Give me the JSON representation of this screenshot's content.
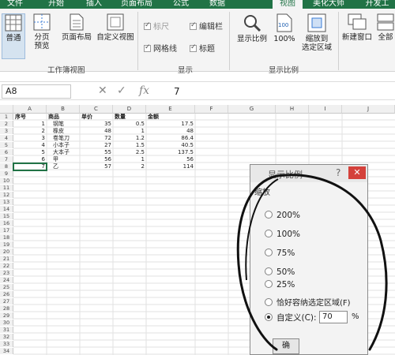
{
  "ribbon_tabs": [
    "文件",
    "开始",
    "插入",
    "页面布局",
    "公式",
    "数据",
    "视图",
    "美化大师",
    "开发工"
  ],
  "active_tab": "视图",
  "ribbon": {
    "normal": "普通",
    "page_break_1": "分页",
    "page_break_2": "预览",
    "page_layout": "页面布局",
    "custom_view": "自定义视图",
    "workbook_views_group": "工作簿视图",
    "ruler": "标尺",
    "formula_bar": "编辑栏",
    "gridlines": "网格线",
    "headings": "标题",
    "show_group": "显示",
    "zoom": "显示比例",
    "zoom_100": "100%",
    "zoom_sel_1": "缩放到",
    "zoom_sel_2": "选定区域",
    "zoom_group": "显示比例",
    "new_window": "新建窗口",
    "arrange_all": "全部"
  },
  "formula_bar": {
    "name_box": "A8",
    "fx_label": "fx",
    "value": "7"
  },
  "columns": [
    "A",
    "B",
    "C",
    "D",
    "E",
    "F",
    "G",
    "H",
    "I",
    "J"
  ],
  "rows": [
    "1",
    "2",
    "3",
    "4",
    "5",
    "6",
    "7",
    "8",
    "9",
    "10",
    "11",
    "12",
    "13",
    "14",
    "15",
    "16",
    "17",
    "18",
    "19",
    "20",
    "21",
    "22",
    "23",
    "24",
    "25",
    "26",
    "27",
    "28",
    "29",
    "30",
    "31",
    "32",
    "33",
    "34",
    "35"
  ],
  "table": {
    "headers": [
      "序号",
      "商品",
      "单价",
      "数量",
      "金额"
    ],
    "rows": [
      [
        "1",
        "钢笔",
        "35",
        "0.5",
        "17.5"
      ],
      [
        "2",
        "橡皮",
        "48",
        "1",
        "48"
      ],
      [
        "3",
        "卷笔刀",
        "72",
        "1.2",
        "86.4"
      ],
      [
        "4",
        "小本子",
        "27",
        "1.5",
        "40.5"
      ],
      [
        "5",
        "大本子",
        "55",
        "2.5",
        "137.5"
      ],
      [
        "6",
        "甲",
        "56",
        "1",
        "56"
      ],
      [
        "7",
        "乙",
        "57",
        "2",
        "114"
      ]
    ]
  },
  "dialog": {
    "title": "显示比例",
    "help": "?",
    "close": "✕",
    "group_label": "缩放",
    "options": [
      "200%",
      "100%",
      "75%",
      "50%",
      "25%",
      "恰好容纳选定区域(F)",
      "自定义(C):"
    ],
    "selected_index": 6,
    "custom_value": "70",
    "percent_sign": "%",
    "ok_label": "确"
  },
  "colors": {
    "excel_green": "#217346",
    "annotation": "#111111"
  }
}
